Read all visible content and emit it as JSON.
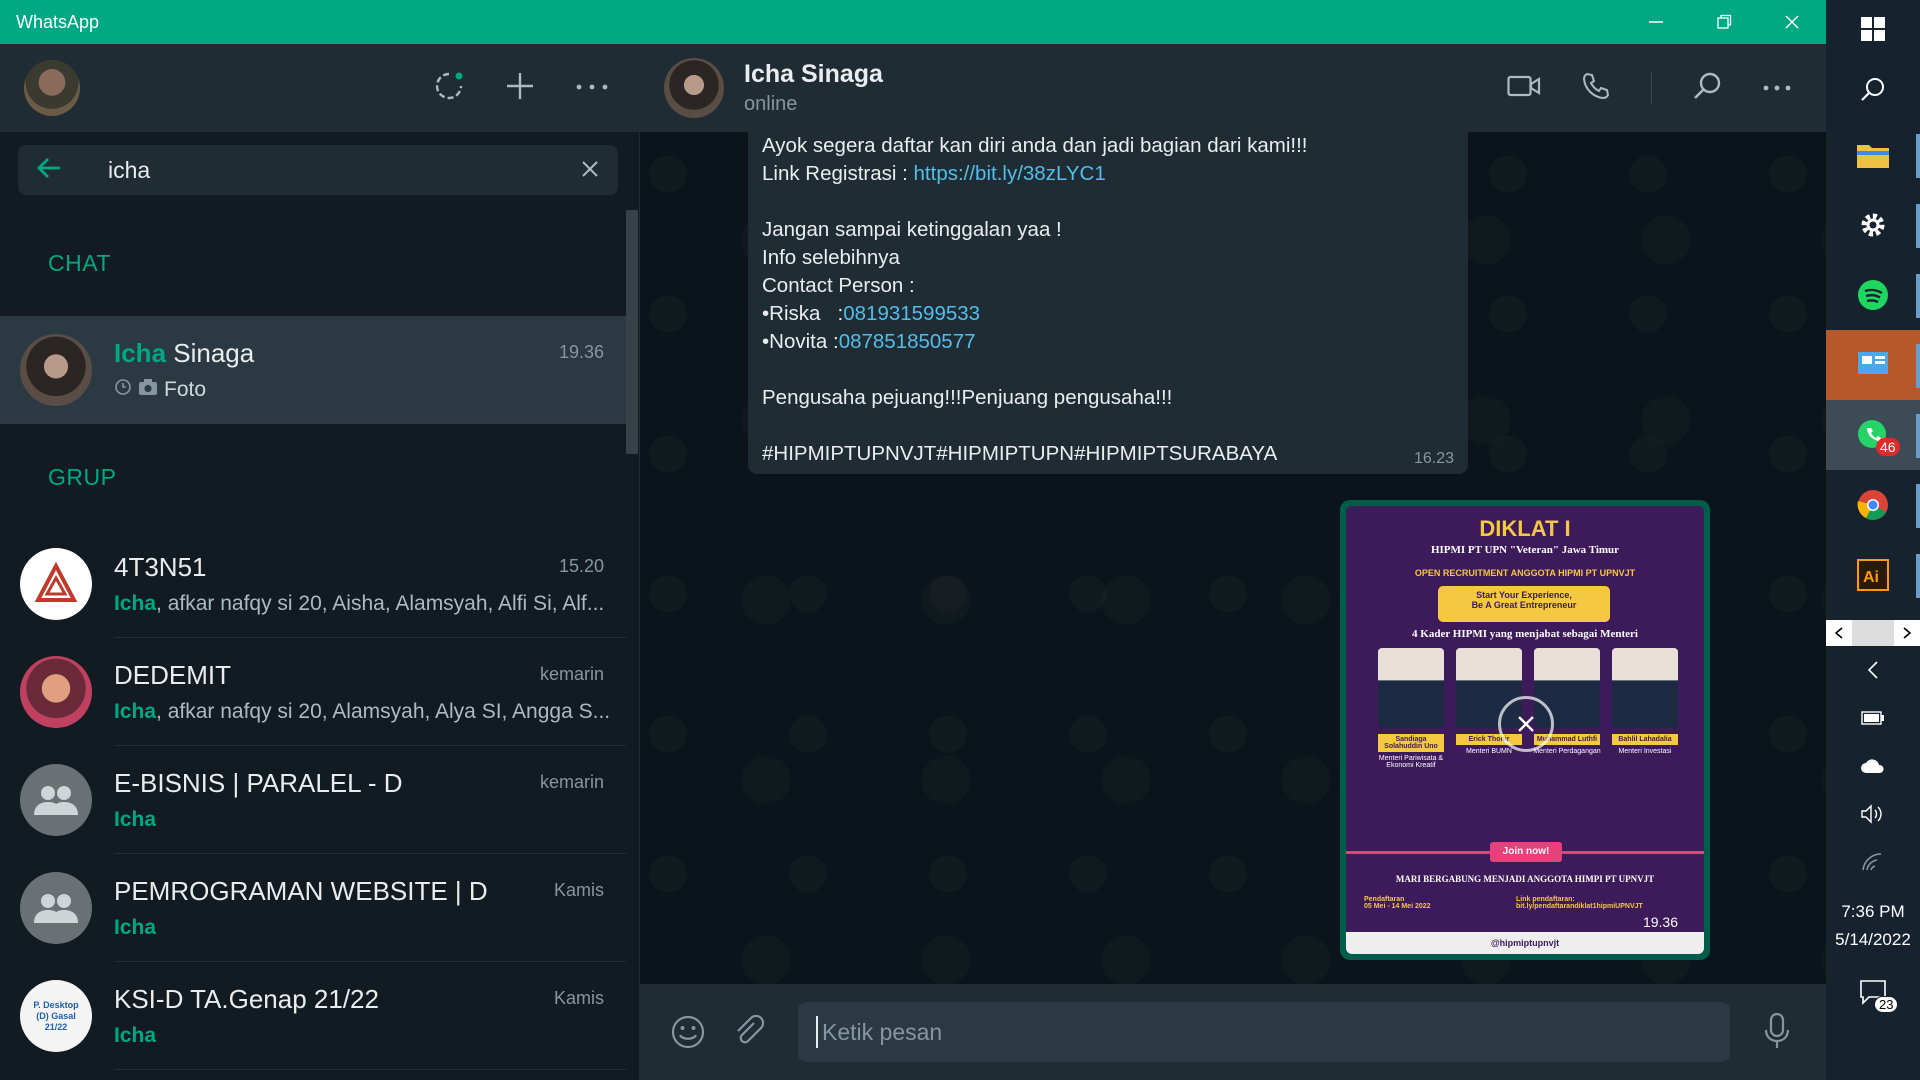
{
  "window": {
    "title": "WhatsApp"
  },
  "search": {
    "value": "icha"
  },
  "sections": {
    "chat": "CHAT",
    "group": "GRUP"
  },
  "chats": [
    {
      "name_hl": "Icha",
      "name_rest": " Sinaga",
      "time": "19.36",
      "preview": "Foto"
    }
  ],
  "groups": [
    {
      "name": "4T3N51",
      "time": "15.20",
      "hl": "Icha",
      "preview": ", afkar nafqy si 20, Aisha, Alamsyah, Alfi Si, Alf..."
    },
    {
      "name": "DEDEMIT",
      "time": "kemarin",
      "hl": "Icha",
      "preview": ", afkar nafqy si 20, Alamsyah, Alya SI, Angga S..."
    },
    {
      "name": "E-BISNIS | PARALEL - D",
      "time": "kemarin",
      "hl": "Icha",
      "preview": ""
    },
    {
      "name": "PEMROGRAMAN WEBSITE | D",
      "time": "Kamis",
      "hl": "Icha",
      "preview": ""
    },
    {
      "name": "KSI-D TA.Genap 21/22",
      "time": "Kamis",
      "hl": "Icha",
      "preview": ""
    }
  ],
  "ksi_avatar_text": "P. Desktop (D) Gasal 21/22",
  "contact": {
    "name": "Icha Sinaga",
    "status": "online"
  },
  "message": {
    "line1": "Ayok segera daftar kan diri anda dan jadi bagian dari kami!!!",
    "reg_label": "Link Registrasi : ",
    "reg_link": "https://bit.ly/38zLYC1",
    "line3": "Jangan sampai ketinggalan yaa !",
    "line4": "Info selebihnya",
    "line5": "Contact Person :",
    "cp1_label": "•Riska   :",
    "cp1_num": "081931599533",
    "cp2_label": "•Novita :",
    "cp2_num": "087851850577",
    "line8": "Pengusaha pejuang!!!Penjuang pengusaha!!!",
    "line9": "#HIPMIPTUPNVJT#HIPMIPTUPN#HIPMIPTSURABAYA",
    "time": "16.23"
  },
  "poster": {
    "title": "DIKLAT I",
    "org": "HIPMI PT UPN \"Veteran\" Jawa Timur",
    "recruit": "OPEN RECRUITMENT ANGGOTA HIPMI PT UPNVJT",
    "slogan1": "Start Your Experience,",
    "slogan2": "Be A Great Entrepreneur",
    "heading": "4 Kader HIPMI yang menjabat sebagai Menteri",
    "people": [
      {
        "name": "Sandiaga Solahuddin Uno",
        "role": "Menteri Pariwisata & Ekonomi Kreatif"
      },
      {
        "name": "Erick Thohir",
        "role": "Menteri BUMN"
      },
      {
        "name": "Muhammad Luthfi",
        "role": "Menteri Perdagangan"
      },
      {
        "name": "Bahlil Lahadalia",
        "role": "Menteri Investasi"
      }
    ],
    "join": "Join now!",
    "invite": "MARI BERGABUNG MENJADI ANGGOTA HIMPI PT UPNVJT",
    "reg_label": "Pendaftaran",
    "reg_dates": "05 Mei - 14 Mei 2022",
    "link_label": "Link pendaftaran:",
    "link_url": "bit.ly/pendaftarandiklat1hipmiUPNVJT",
    "ig": "@hipmiptupnvjt",
    "time": "19.36"
  },
  "composer": {
    "placeholder": "Ketik pesan"
  },
  "taskbar": {
    "whatsapp_badge": "46",
    "time": "7:36 PM",
    "date": "5/14/2022",
    "notif_badge": "23"
  },
  "colors": {
    "accent": "#00a884",
    "link": "#53bdeb",
    "panel": "#202c33",
    "bg": "#111b21"
  }
}
